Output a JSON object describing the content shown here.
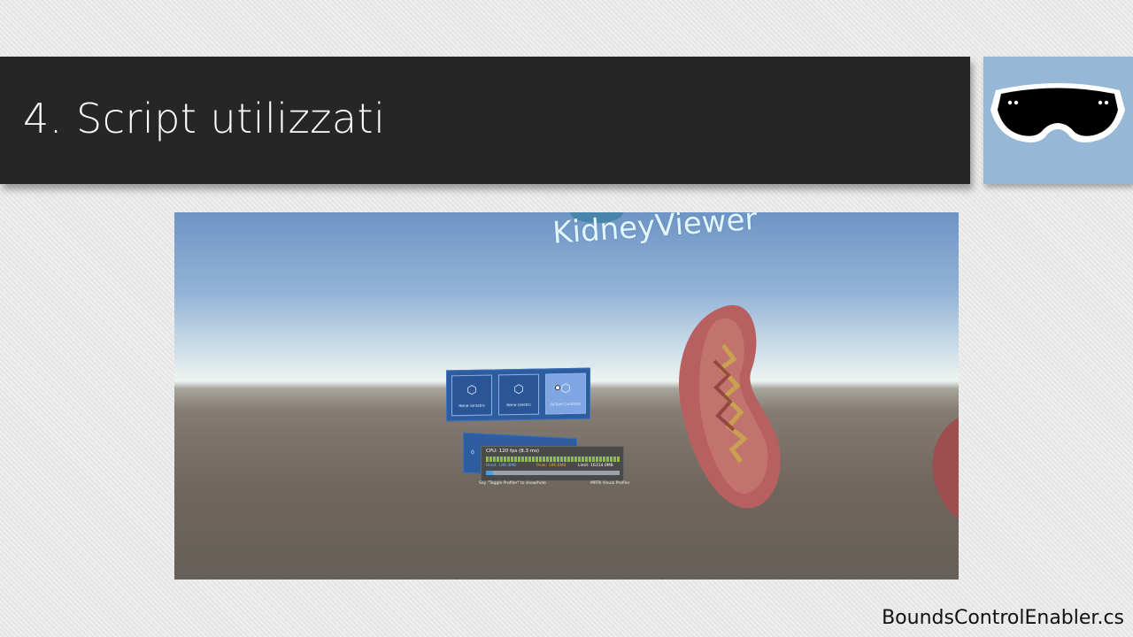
{
  "slide": {
    "title": "4. Script utilizzati",
    "footer_filename": "BoundsControlEnabler.cs"
  },
  "logo": {
    "icon": "hololens-headset-icon"
  },
  "app_screenshot": {
    "app_title": "KidneyViewer",
    "menu_buttons": [
      {
        "label": "Rene Sinistro",
        "icon": "cube-icon"
      },
      {
        "label": "Rene Destro",
        "icon": "cube-icon"
      },
      {
        "label": "Active Controls",
        "icon": "cube-icon",
        "active": true
      }
    ],
    "diagnostics": {
      "panel_number": "0",
      "cpu": "CPU: 120 fps (8.3 ms)",
      "memory_used": "Used: 180.4MB",
      "memory_peak": "Peak: 186.6MB",
      "memory_limit": "Limit: 16314.0MB",
      "caption_left": "Say \"Toggle Profiler\" to show/hide",
      "caption_right": "MRTK Visual Profiler"
    },
    "colors": {
      "panel_blue": "#2e5d9f",
      "fps_green": "#8fc13b",
      "kidney": "#b86060"
    }
  }
}
